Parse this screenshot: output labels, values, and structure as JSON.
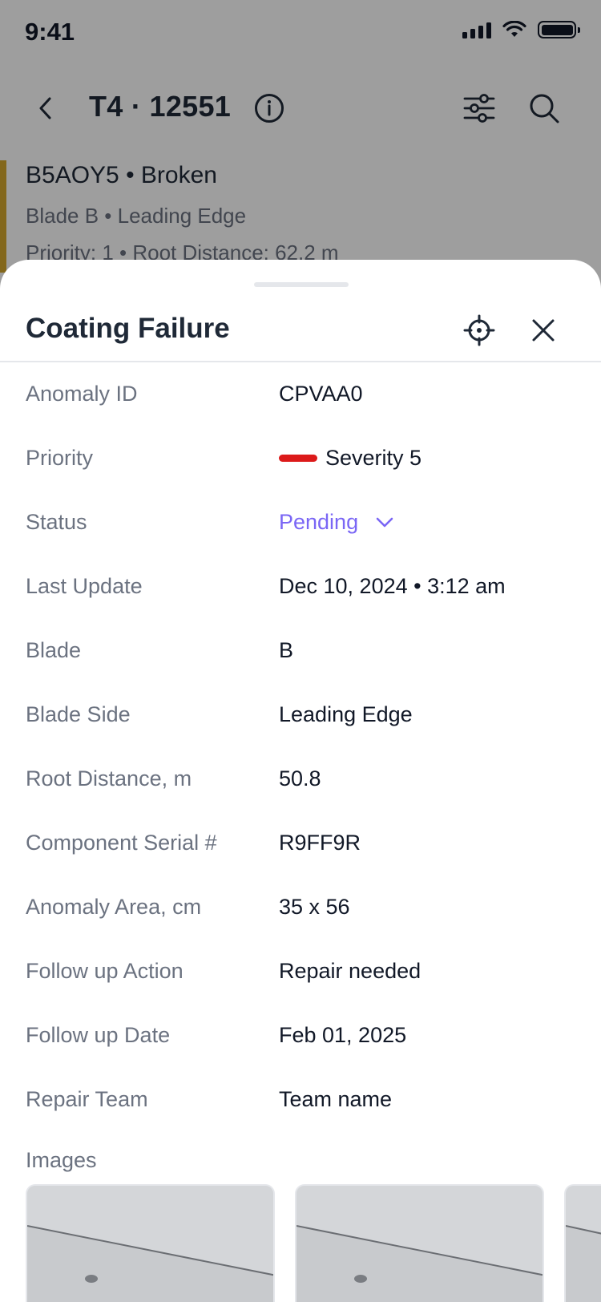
{
  "status_bar": {
    "time": "9:41"
  },
  "nav": {
    "title": "T4 · 12551"
  },
  "list_item": {
    "title": "B5AOY5 • Broken",
    "subtitle": "Blade B • Leading Edge",
    "meta": "Priority: 1 • Root Distance: 62.2 m"
  },
  "sheet": {
    "title": "Coating Failure",
    "rows": [
      {
        "label": "Anomaly ID",
        "value": "CPVAA0"
      },
      {
        "label": "Priority",
        "value": "Severity 5"
      },
      {
        "label": "Status",
        "value": "Pending"
      },
      {
        "label": "Last Update",
        "value": "Dec 10, 2024 • 3:12 am"
      },
      {
        "label": "Blade",
        "value": "B"
      },
      {
        "label": "Blade Side",
        "value": "Leading Edge"
      },
      {
        "label": "Root Distance, m",
        "value": "50.8"
      },
      {
        "label": "Component Serial #",
        "value": "R9FF9R"
      },
      {
        "label": "Anomaly Area, cm",
        "value": "35 x 56"
      },
      {
        "label": "Follow up Action",
        "value": "Repair needed"
      },
      {
        "label": "Follow up Date",
        "value": "Feb 01, 2025"
      },
      {
        "label": "Repair Team",
        "value": "Team name"
      }
    ],
    "images_label": "Images"
  },
  "colors": {
    "accent": "#7a66f5",
    "severity": "#dc1a1a",
    "list_accent": "#d4a72c"
  },
  "icons": [
    "back-icon",
    "info-icon",
    "filter-icon",
    "search-icon",
    "locate-icon",
    "close-icon",
    "chevron-down-icon"
  ]
}
